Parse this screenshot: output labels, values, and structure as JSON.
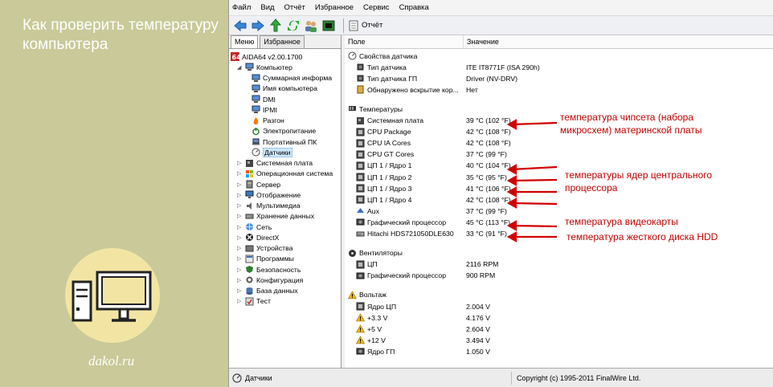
{
  "left": {
    "title": "Как проверить температуру компьютера",
    "site": "dakol.ru"
  },
  "menu": [
    "Файл",
    "Вид",
    "Отчёт",
    "Избранное",
    "Сервис",
    "Справка"
  ],
  "toolbar": {
    "report_label": "Отчёт"
  },
  "tabs": [
    "Меню",
    "Избранное"
  ],
  "tree": [
    {
      "label": "AIDA64 v2.00.1700",
      "icon": "aida-icon",
      "indent": 0
    },
    {
      "label": "Компьютер",
      "icon": "computer-icon",
      "indent": 1,
      "arrow": "◢"
    },
    {
      "label": "Суммарная информа",
      "icon": "computer-icon",
      "indent": 2
    },
    {
      "label": "Имя компьютера",
      "icon": "computer-icon",
      "indent": 2
    },
    {
      "label": "DMI",
      "icon": "computer-icon",
      "indent": 2
    },
    {
      "label": "IPMI",
      "icon": "computer-icon",
      "indent": 2
    },
    {
      "label": "Разгон",
      "icon": "flame-icon",
      "indent": 2
    },
    {
      "label": "Электропитание",
      "icon": "power-icon",
      "indent": 2
    },
    {
      "label": "Портативный ПК",
      "icon": "laptop-icon",
      "indent": 2
    },
    {
      "label": "Датчики",
      "icon": "sensor-icon",
      "indent": 2,
      "selected": true
    },
    {
      "label": "Системная плата",
      "icon": "motherboard-icon",
      "indent": 1,
      "arrow": "▷"
    },
    {
      "label": "Операционная система",
      "icon": "windows-icon",
      "indent": 1,
      "arrow": "▷"
    },
    {
      "label": "Сервер",
      "icon": "server-icon",
      "indent": 1,
      "arrow": "▷"
    },
    {
      "label": "Отображение",
      "icon": "display-icon",
      "indent": 1,
      "arrow": "▷"
    },
    {
      "label": "Мультимедиа",
      "icon": "multimedia-icon",
      "indent": 1,
      "arrow": "▷"
    },
    {
      "label": "Хранение данных",
      "icon": "storage-icon",
      "indent": 1,
      "arrow": "▷"
    },
    {
      "label": "Сеть",
      "icon": "network-icon",
      "indent": 1,
      "arrow": "▷"
    },
    {
      "label": "DirectX",
      "icon": "directx-icon",
      "indent": 1,
      "arrow": "▷"
    },
    {
      "label": "Устройства",
      "icon": "devices-icon",
      "indent": 1,
      "arrow": "▷"
    },
    {
      "label": "Программы",
      "icon": "programs-icon",
      "indent": 1,
      "arrow": "▷"
    },
    {
      "label": "Безопасность",
      "icon": "security-icon",
      "indent": 1,
      "arrow": "▷"
    },
    {
      "label": "Конфигурация",
      "icon": "config-icon",
      "indent": 1,
      "arrow": "▷"
    },
    {
      "label": "База данных",
      "icon": "database-icon",
      "indent": 1,
      "arrow": "▷"
    },
    {
      "label": "Тест",
      "icon": "test-icon",
      "indent": 1,
      "arrow": "▷"
    }
  ],
  "columns": {
    "field": "Поле",
    "value": "Значение"
  },
  "rows": [
    {
      "type": "section",
      "label": "Свойства датчика",
      "icon": "sensor-icon"
    },
    {
      "label": "Тип датчика",
      "value": "ITE IT8771F  (ISA 290h)",
      "icon": "chip-icon"
    },
    {
      "label": "Тип датчика ГП",
      "value": "Driver  (NV-DRV)",
      "icon": "chip-icon"
    },
    {
      "label": "Обнаружено вскрытие кор...",
      "value": "Нет",
      "icon": "case-icon"
    },
    {
      "type": "gap"
    },
    {
      "type": "section",
      "label": "Температуры",
      "icon": "thermometer-icon"
    },
    {
      "label": "Системная плата",
      "value": "39 °C  (102 °F)",
      "icon": "motherboard-icon"
    },
    {
      "label": "CPU Package",
      "value": "42 °C  (108 °F)",
      "icon": "cpu-icon"
    },
    {
      "label": "CPU IA Cores",
      "value": "42 °C  (108 °F)",
      "icon": "cpu-icon"
    },
    {
      "label": "CPU GT Cores",
      "value": "37 °C  (99 °F)",
      "icon": "cpu-icon"
    },
    {
      "label": "ЦП 1 / Ядро 1",
      "value": "40 °C  (104 °F)",
      "icon": "cpu-icon"
    },
    {
      "label": "ЦП 1 / Ядро 2",
      "value": "35 °C  (95 °F)",
      "icon": "cpu-icon"
    },
    {
      "label": "ЦП 1 / Ядро 3",
      "value": "41 °C  (106 °F)",
      "icon": "cpu-icon"
    },
    {
      "label": "ЦП 1 / Ядро 4",
      "value": "42 °C  (108 °F)",
      "icon": "cpu-icon"
    },
    {
      "label": "Aux",
      "value": "37 °C  (99 °F)",
      "icon": "aux-icon"
    },
    {
      "label": "Графический процессор",
      "value": "45 °C  (113 °F)",
      "icon": "gpu-icon"
    },
    {
      "label": "Hitachi HDS721050DLE630",
      "value": "33 °C  (91 °F)",
      "icon": "hdd-icon"
    },
    {
      "type": "gap"
    },
    {
      "type": "section",
      "label": "Вентиляторы",
      "icon": "fan-icon"
    },
    {
      "label": "ЦП",
      "value": "2116 RPM",
      "icon": "cpu-icon"
    },
    {
      "label": "Графический процессор",
      "value": "900 RPM",
      "icon": "gpu-icon"
    },
    {
      "type": "gap"
    },
    {
      "type": "section",
      "label": "Вольтаж",
      "icon": "warning-icon"
    },
    {
      "label": "Ядро ЦП",
      "value": "2.004 V",
      "icon": "cpu-icon"
    },
    {
      "label": "+3.3 V",
      "value": "4.176 V",
      "icon": "warning-icon"
    },
    {
      "label": "+5 V",
      "value": "2.604 V",
      "icon": "warning-icon"
    },
    {
      "label": "+12 V",
      "value": "3.494 V",
      "icon": "warning-icon"
    },
    {
      "label": "Ядро ГП",
      "value": "1.050 V",
      "icon": "gpu-icon"
    }
  ],
  "annotations": {
    "chipset": "температура чипсета (набора микросхем) материнской платы",
    "cores": "температуры ядер центрального процессора",
    "gpu": "температура видеокарты",
    "hdd": "температура жесткого диска HDD"
  },
  "status": {
    "left": "Датчики",
    "right": "Copyright (c) 1995-2011 FinalWire Ltd."
  },
  "colors": {
    "annotation": "#c00000",
    "accent": "#2a7fd4"
  }
}
